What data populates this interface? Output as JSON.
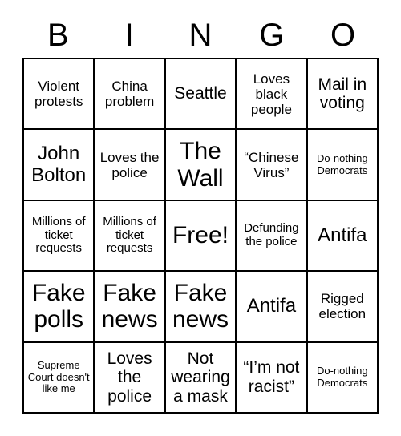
{
  "card": {
    "header_letters": [
      "B",
      "I",
      "N",
      "G",
      "O"
    ],
    "rows": [
      [
        {
          "text": "Violent protests",
          "size": "md"
        },
        {
          "text": "China problem",
          "size": "md"
        },
        {
          "text": "Seattle",
          "size": "lg"
        },
        {
          "text": "Loves black people",
          "size": "md"
        },
        {
          "text": "Mail in voting",
          "size": "lg"
        }
      ],
      [
        {
          "text": "John Bolton",
          "size": "xl"
        },
        {
          "text": "Loves the police",
          "size": "md"
        },
        {
          "text": "The Wall",
          "size": "xxl"
        },
        {
          "text": "“Chinese Virus”",
          "size": "md"
        },
        {
          "text": "Do-nothing Democrats",
          "size": "xs"
        }
      ],
      [
        {
          "text": "Millions of ticket requests",
          "size": "sm"
        },
        {
          "text": "Millions of ticket requests",
          "size": "sm"
        },
        {
          "text": "Free!",
          "size": "xxl"
        },
        {
          "text": "Defunding the police",
          "size": "sm"
        },
        {
          "text": "Antifa",
          "size": "xl"
        }
      ],
      [
        {
          "text": "Fake polls",
          "size": "xxl"
        },
        {
          "text": "Fake news",
          "size": "xxl"
        },
        {
          "text": "Fake news",
          "size": "xxl"
        },
        {
          "text": "Antifa",
          "size": "xl"
        },
        {
          "text": "Rigged election",
          "size": "md"
        }
      ],
      [
        {
          "text": "Supreme Court doesn't like me",
          "size": "xs"
        },
        {
          "text": "Loves the police",
          "size": "lg"
        },
        {
          "text": "Not wearing a mask",
          "size": "lg"
        },
        {
          "text": "“I’m not racist”",
          "size": "lg"
        },
        {
          "text": "Do-nothing Democrats",
          "size": "xs"
        }
      ]
    ],
    "colors": {
      "background": "#ffffff",
      "text": "#000000",
      "border": "#000000"
    }
  }
}
